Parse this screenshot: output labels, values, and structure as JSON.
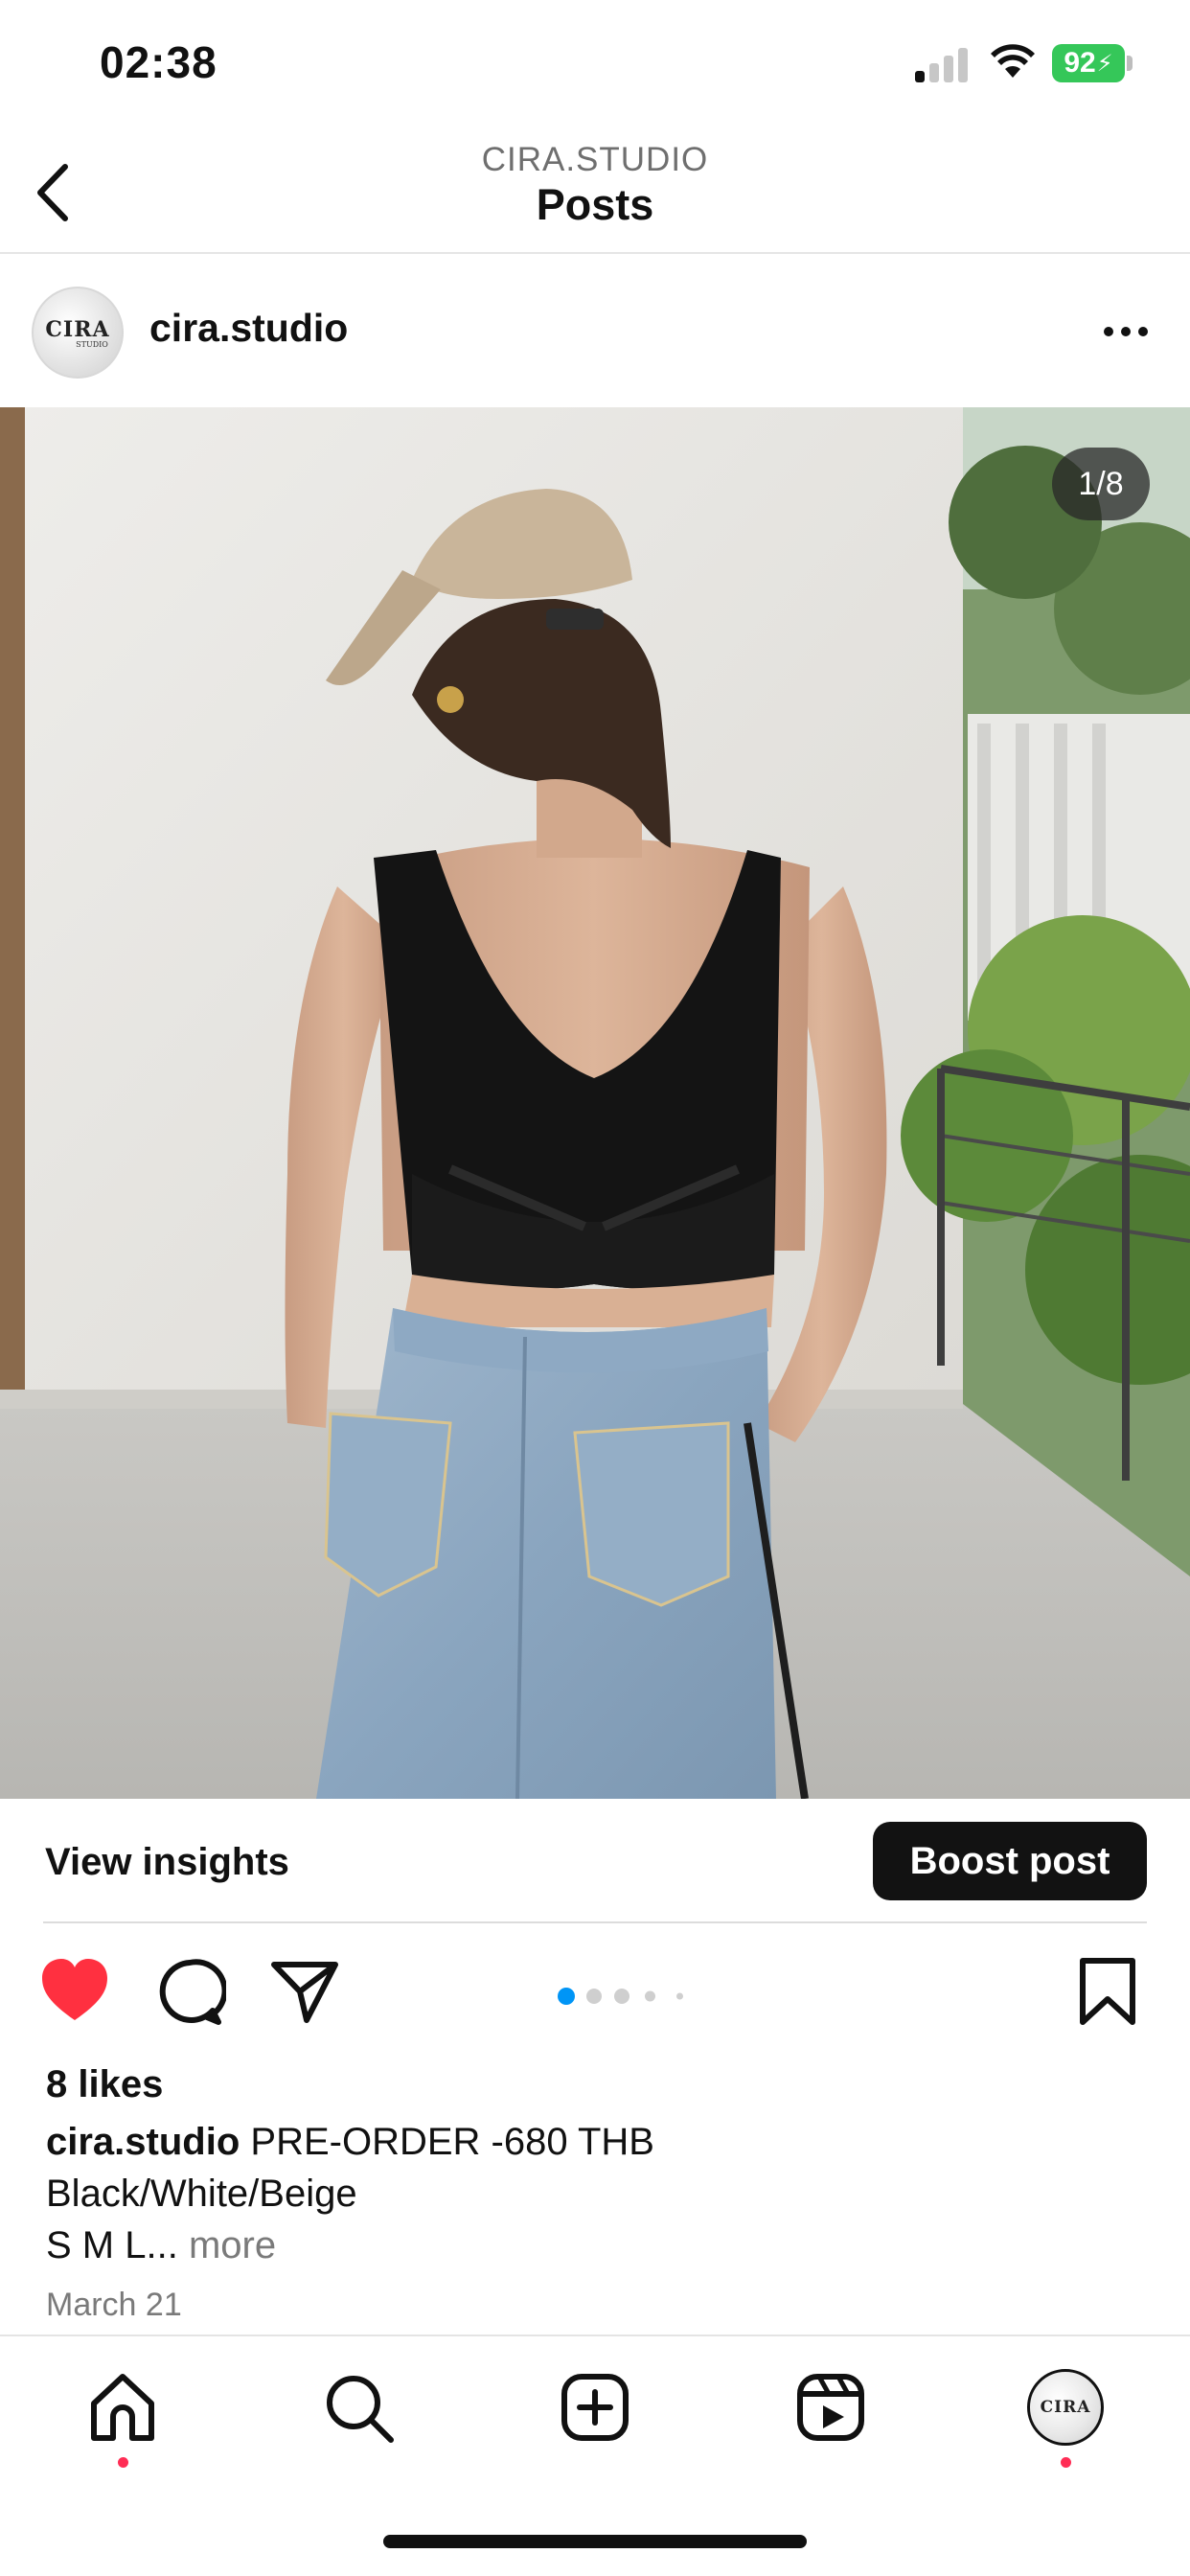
{
  "status_bar": {
    "time": "02:38",
    "battery": "92"
  },
  "header": {
    "subtitle": "CIRA.STUDIO",
    "title": "Posts"
  },
  "post": {
    "username": "cira.studio",
    "avatar_text": "CIRA",
    "avatar_subtext": "STUDIO",
    "page_indicator": "1/8",
    "carousel": {
      "current_slide": 1,
      "total_slides": 8
    },
    "view_insights_label": "View insights",
    "boost_label": "Boost post",
    "likes": "8 likes",
    "caption_user": "cira.studio",
    "caption_line1": "PRE-ORDER -680 THB",
    "caption_line2": "Black/White/Beige",
    "caption_line3": "S M L...",
    "more_label": "more",
    "date": "March 21",
    "liked": true
  },
  "icons": {
    "back": "chevron-left-icon",
    "options": "more-horizontal-icon",
    "like": "heart-icon",
    "comment": "comment-bubble-icon",
    "share": "paper-plane-icon",
    "save": "bookmark-icon"
  },
  "tabbar": {
    "items": [
      "home",
      "search",
      "create",
      "reels",
      "profile"
    ],
    "active": "home"
  },
  "colors": {
    "like": "#ff3040",
    "accent": "#0095f6",
    "battery": "#35c759",
    "notification_dot": "#ff2d55"
  }
}
